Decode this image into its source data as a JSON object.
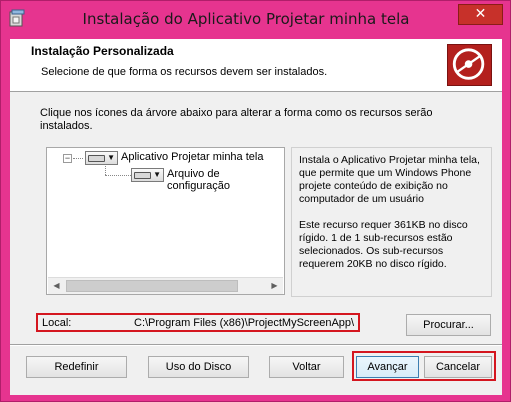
{
  "window": {
    "title": "Instalação do Aplicativo Projetar minha tela",
    "close_label": "✕"
  },
  "header": {
    "title": "Instalação Personalizada",
    "subtitle": "Selecione de que forma os recursos devem ser instalados.",
    "logo_icon": "disc-icon"
  },
  "instructions": "Clique nos ícones da árvore abaixo para alterar a forma como os recursos serão instalados.",
  "tree": {
    "items": [
      {
        "label": "Aplicativo Projetar minha tela",
        "icon": "drive-icon"
      },
      {
        "label": "Arquivo de configuração",
        "icon": "drive-icon"
      }
    ]
  },
  "description": {
    "text": "Instala o Aplicativo Projetar minha tela, que permite que um Windows Phone projete conteúdo de exibição no computador de um usuário",
    "requirements": "Este recurso requer 361KB no disco rígido. 1 de 1 sub-recursos estão selecionados. Os sub-recursos requerem 20KB no disco rígido."
  },
  "location": {
    "label": "Local:",
    "path": "C:\\Program Files (x86)\\ProjectMyScreenApp\\"
  },
  "buttons": {
    "browse": "Procurar...",
    "reset": "Redefinir",
    "disk_usage": "Uso do Disco",
    "back": "Voltar",
    "next": "Avançar",
    "cancel": "Cancelar"
  },
  "colors": {
    "window_frame": "#e6348f",
    "close_button": "#c7312a",
    "highlight": "#d4161f",
    "logo": "#b3201d"
  }
}
